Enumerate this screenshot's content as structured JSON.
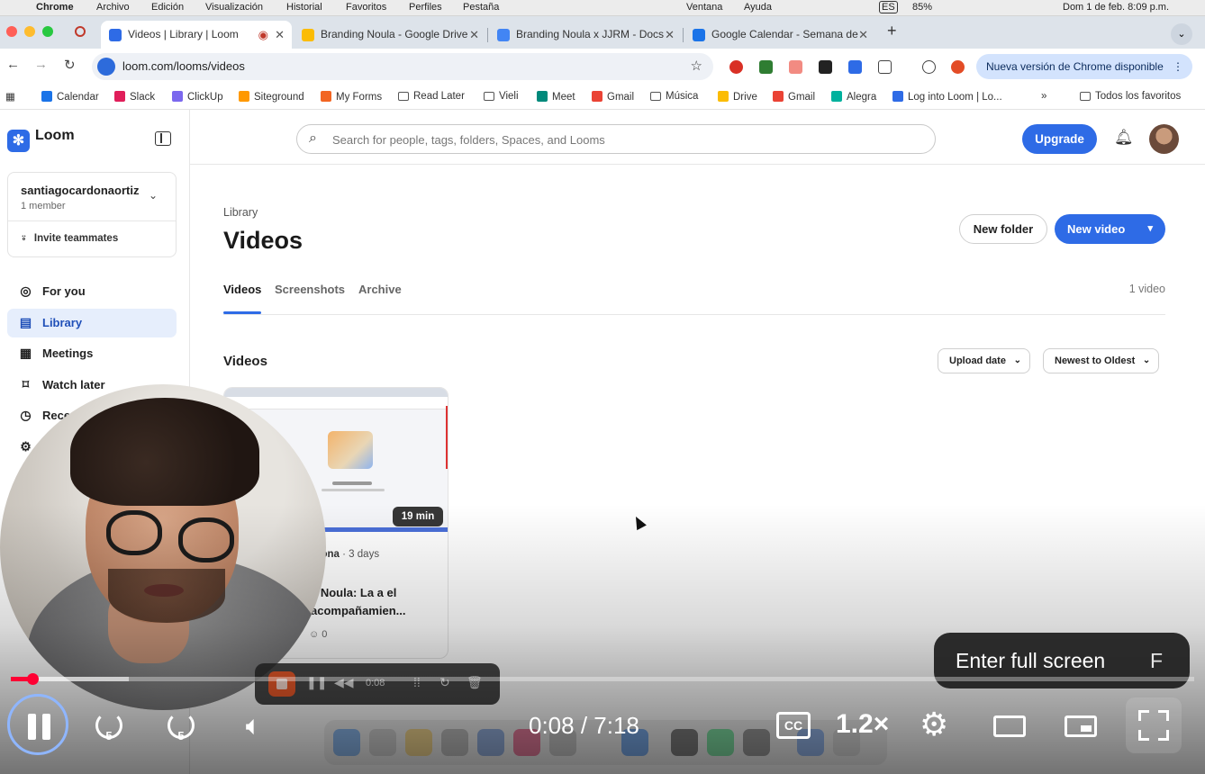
{
  "mac_menu": {
    "app": "Chrome",
    "items": [
      "Archivo",
      "Edición",
      "Visualización",
      "Historial",
      "Favoritos",
      "Perfiles",
      "Pestaña"
    ],
    "right_items": [
      "Ventana",
      "Ayuda"
    ],
    "lang": "ES",
    "battery": "85%",
    "clock": "Dom 1 de feb. 8:09 p.m."
  },
  "tabs": [
    {
      "title": "Videos | Library | Loom",
      "active": true,
      "color": "#2e6be6"
    },
    {
      "title": "Branding Noula - Google Drive",
      "active": false,
      "color": "#1fa463"
    },
    {
      "title": "Branding Noula x JJRM - Docs",
      "active": false,
      "color": "#4285f4"
    },
    {
      "title": "Google Calendar - Semana de",
      "active": false,
      "color": "#1a73e8"
    }
  ],
  "toolbar": {
    "url": "loom.com/looms/videos",
    "update_label": "Nueva versión de Chrome disponible"
  },
  "bookmarks": [
    {
      "label": "Calendar",
      "color": "#1a73e8",
      "folder": false
    },
    {
      "label": "Slack",
      "color": "#e01e5a",
      "folder": false
    },
    {
      "label": "ClickUp",
      "color": "#7b68ee",
      "folder": false
    },
    {
      "label": "Siteground",
      "color": "#ff9900",
      "folder": false
    },
    {
      "label": "My Forms",
      "color": "#f26522",
      "folder": false
    },
    {
      "label": "Read Later",
      "color": "",
      "folder": true
    },
    {
      "label": "Vieli",
      "color": "",
      "folder": true
    },
    {
      "label": "Meet",
      "color": "#00897b",
      "folder": false
    },
    {
      "label": "Gmail",
      "color": "#ea4335",
      "folder": false
    },
    {
      "label": "Música",
      "color": "",
      "folder": true
    },
    {
      "label": "Drive",
      "color": "#fbbc04",
      "folder": false
    },
    {
      "label": "Gmail",
      "color": "#ea4335",
      "folder": false
    },
    {
      "label": "Alegra",
      "color": "#00b19d",
      "folder": false
    },
    {
      "label": "Log into Loom | Lo...",
      "color": "#2e6be6",
      "folder": false
    }
  ],
  "bookmarks_all": "Todos los favoritos",
  "loom": {
    "brand": "Loom",
    "workspace": {
      "name": "santiagocardonaortiz",
      "members": "1 member",
      "invite": "Invite teammates"
    },
    "nav": [
      {
        "label": "For you",
        "icon": "user-circle-icon",
        "active": false
      },
      {
        "label": "Library",
        "icon": "library-icon",
        "active": true
      },
      {
        "label": "Meetings",
        "icon": "calendar-icon",
        "active": false
      },
      {
        "label": "Watch later",
        "icon": "bookmark-icon",
        "active": false
      },
      {
        "label": "Rece",
        "icon": "clock-icon",
        "active": false
      }
    ],
    "search_placeholder": "Search for people, tags, folders, Spaces, and Looms",
    "upgrade": "Upgrade",
    "breadcrumb": "Library",
    "title": "Videos",
    "new_folder": "New folder",
    "new_video": "New video",
    "tabs": [
      {
        "label": "Videos",
        "active": true
      },
      {
        "label": "Screenshots",
        "active": false
      },
      {
        "label": "Archive",
        "active": false
      }
    ],
    "video_count": "1 video",
    "section": "Videos",
    "filters": {
      "sort_by": "Upload date",
      "order": "Newest to Oldest"
    },
    "video": {
      "duration": "19 min",
      "author": "rdona",
      "age": "· 3 days",
      "title": "e Noula: La a el acompañamien...",
      "reactions": "0"
    }
  },
  "recorder": {
    "time": "0:08"
  },
  "player": {
    "current": "0:08",
    "total": "7:18",
    "progress_fraction": 0.0186,
    "buffered_fraction": 0.1,
    "skip_seconds": "5",
    "captions": "CC",
    "speed": "1.2×",
    "tooltip": "Enter full screen",
    "tooltip_key": "F",
    "accent": "#ff0033"
  }
}
